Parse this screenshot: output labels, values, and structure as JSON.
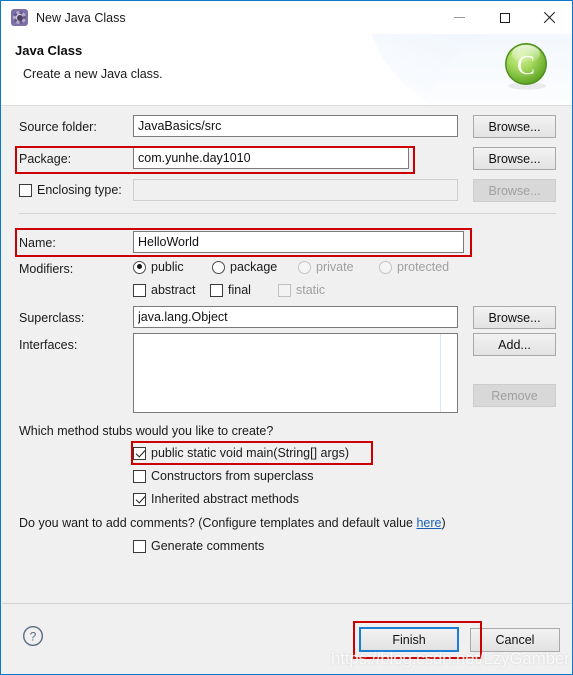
{
  "window": {
    "title": "New Java Class",
    "icon": "java-class-wizard-icon",
    "controls": {
      "minimize": "minimize-icon",
      "maximize": "maximize-icon",
      "close": "close-icon"
    }
  },
  "header": {
    "title": "Java Class",
    "subtitle": "Create a new Java class.",
    "badge_letter": "C",
    "badge_icon": "java-class-green-badge"
  },
  "form": {
    "source_folder": {
      "label": "Source folder:",
      "value": "JavaBasics/src",
      "browse": "Browse..."
    },
    "package": {
      "label": "Package:",
      "value": "com.yunhe.day1010",
      "browse": "Browse...",
      "highlighted": true
    },
    "enclosing_type": {
      "label": "Enclosing type:",
      "value": "",
      "checked": false,
      "browse": "Browse...",
      "disabled": true
    },
    "name": {
      "label": "Name:",
      "value": "HelloWorld",
      "highlighted": true
    },
    "modifiers": {
      "label": "Modifiers:",
      "radios": [
        {
          "label": "public",
          "selected": true,
          "disabled": false
        },
        {
          "label": "package",
          "selected": false,
          "disabled": false
        },
        {
          "label": "private",
          "selected": false,
          "disabled": true
        },
        {
          "label": "protected",
          "selected": false,
          "disabled": true
        }
      ],
      "checkboxes": [
        {
          "label": "abstract",
          "checked": false,
          "disabled": false
        },
        {
          "label": "final",
          "checked": false,
          "disabled": false
        },
        {
          "label": "static",
          "checked": false,
          "disabled": true
        }
      ]
    },
    "superclass": {
      "label": "Superclass:",
      "value": "java.lang.Object",
      "browse": "Browse..."
    },
    "interfaces": {
      "label": "Interfaces:",
      "items": [],
      "add": "Add...",
      "remove": "Remove",
      "remove_disabled": true
    },
    "stubs": {
      "question": "Which method stubs would you like to create?",
      "options": [
        {
          "label": "public static void main(String[] args)",
          "checked": true,
          "highlighted": true
        },
        {
          "label": "Constructors from superclass",
          "checked": false,
          "highlighted": false
        },
        {
          "label": "Inherited abstract methods",
          "checked": true,
          "highlighted": false
        }
      ]
    },
    "comments": {
      "question_prefix": "Do you want to add comments? (Configure templates and default value ",
      "link": "here",
      "question_suffix": ")",
      "checkbox": {
        "label": "Generate comments",
        "checked": false
      }
    }
  },
  "footer": {
    "help": "help-icon",
    "finish": "Finish",
    "cancel": "Cancel",
    "finish_highlighted": true,
    "finish_focused": true
  },
  "watermark": "https://blog.csdn.net/LzyGamber",
  "colors": {
    "window_border": "#0a7ac8",
    "annotation_red": "#cc0000",
    "focus_blue": "#1a7fd4",
    "badge_green": "#7dc13f",
    "link_blue": "#1a5fb4",
    "dialog_bg": "#f0f0f0"
  }
}
